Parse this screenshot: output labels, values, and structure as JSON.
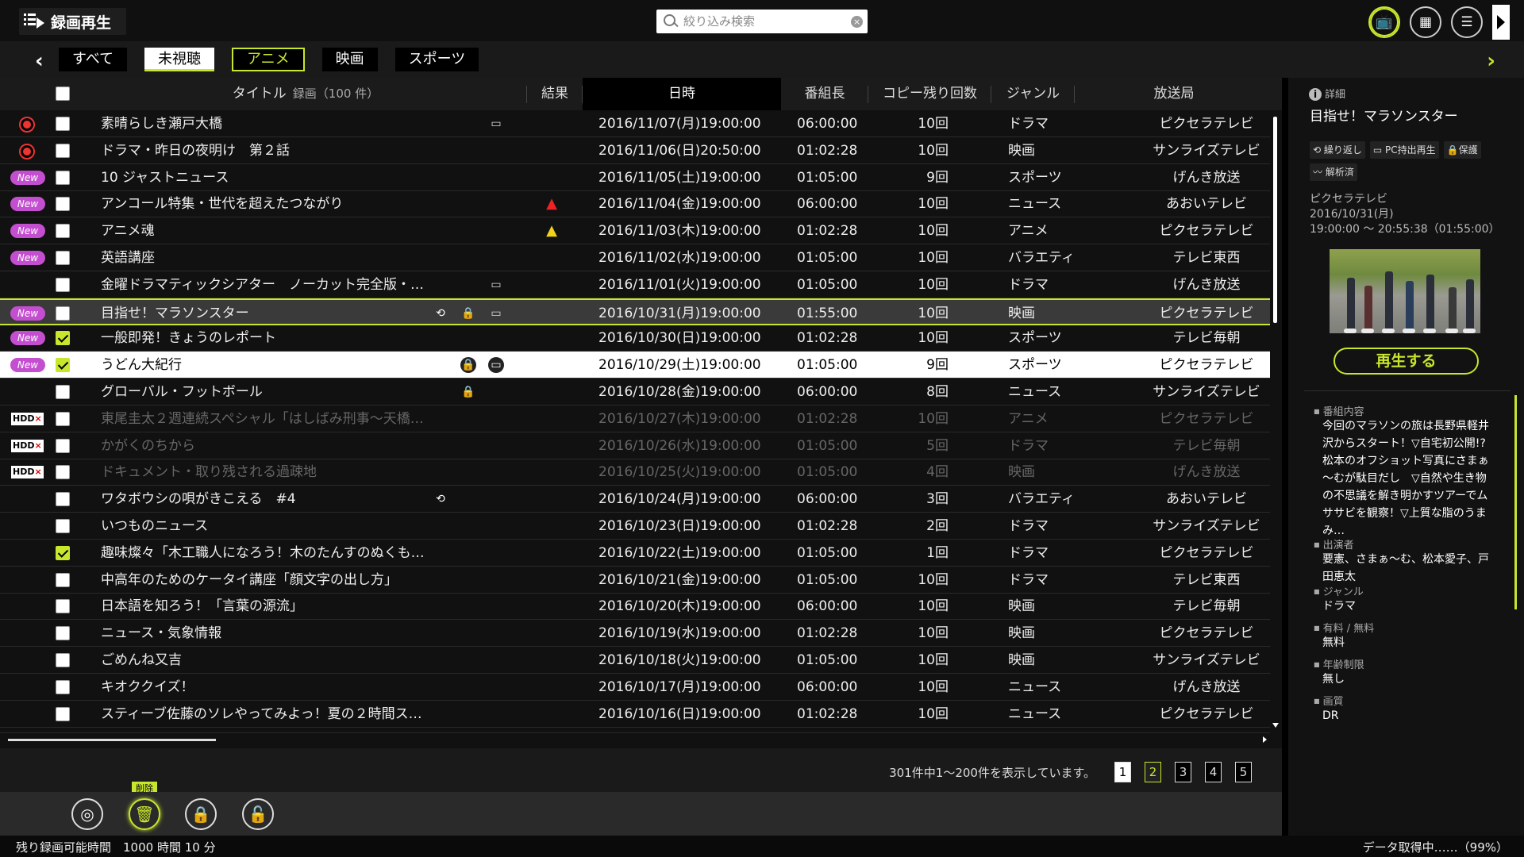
{
  "app": {
    "title": "録画再生"
  },
  "search": {
    "placeholder": "絞り込み検索"
  },
  "categories": [
    "すべて",
    "未視聴",
    "アニメ",
    "映画",
    "スポーツ"
  ],
  "table": {
    "headers": {
      "title": "タイトル",
      "title_sub": "録画（100 件）",
      "result": "結果",
      "date": "日時",
      "length": "番組長",
      "copy": "コピー残り回数",
      "genre": "ジャンル",
      "channel": "放送局"
    },
    "rows": [
      {
        "badge": "rec",
        "checked": false,
        "title": "素晴らしき瀬戸大橋",
        "date": "2016/11/07(月)19:00:00",
        "length": "06:00:00",
        "copy": "10回",
        "genre": "ドラマ",
        "channel": "ピクセラテレビ"
      },
      {
        "badge": "rec",
        "checked": false,
        "title": "ドラマ・昨日の夜明け　第２話",
        "date": "2016/11/06(日)20:50:00",
        "length": "01:02:28",
        "copy": "10回",
        "genre": "映画",
        "channel": "サンライズテレビ"
      },
      {
        "badge": "new",
        "checked": false,
        "title": "10 ジャストニュース",
        "date": "2016/11/05(土)19:00:00",
        "length": "01:05:00",
        "copy": "9回",
        "genre": "スポーツ",
        "channel": "げんき放送"
      },
      {
        "badge": "new",
        "checked": false,
        "title": "アンコール特集・世代を超えたつながり",
        "date": "2016/11/04(金)19:00:00",
        "length": "06:00:00",
        "copy": "10回",
        "genre": "ニュース",
        "channel": "あおいテレビ"
      },
      {
        "badge": "new",
        "checked": false,
        "title": "アニメ魂",
        "date": "2016/11/03(木)19:00:00",
        "length": "01:02:28",
        "copy": "10回",
        "genre": "アニメ",
        "channel": "ピクセラテレビ"
      },
      {
        "badge": "new",
        "checked": false,
        "title": "英語講座",
        "date": "2016/11/02(水)19:00:00",
        "length": "01:05:00",
        "copy": "10回",
        "genre": "バラエティ",
        "channel": "テレビ東西"
      },
      {
        "badge": "",
        "checked": false,
        "title": "金曜ドラマティックシアター　ノーカット完全版・…",
        "date": "2016/11/01(火)19:00:00",
        "length": "01:05:00",
        "copy": "10回",
        "genre": "ドラマ",
        "channel": "げんき放送"
      },
      {
        "badge": "new",
        "checked": false,
        "title": "目指せ！マラソンスター",
        "date": "2016/10/31(月)19:00:00",
        "length": "01:55:00",
        "copy": "10回",
        "genre": "映画",
        "channel": "ピクセラテレビ"
      },
      {
        "badge": "new",
        "checked": true,
        "title": "一般即発！きょうのレポート",
        "date": "2016/10/30(日)19:00:00",
        "length": "01:02:28",
        "copy": "10回",
        "genre": "スポーツ",
        "channel": "テレビ毎朝"
      },
      {
        "badge": "new",
        "checked": true,
        "title": "うどん大紀行",
        "date": "2016/10/29(土)19:00:00",
        "length": "01:05:00",
        "copy": "9回",
        "genre": "スポーツ",
        "channel": "ピクセラテレビ"
      },
      {
        "badge": "",
        "checked": false,
        "title": "グローバル・フットボール",
        "date": "2016/10/28(金)19:00:00",
        "length": "06:00:00",
        "copy": "8回",
        "genre": "ニュース",
        "channel": "サンライズテレビ"
      },
      {
        "badge": "hdd",
        "checked": false,
        "title": "東尾圭太２週連続スペシャル「はしばみ刑事～天橋…",
        "date": "2016/10/27(木)19:00:00",
        "length": "01:02:28",
        "copy": "10回",
        "genre": "アニメ",
        "channel": "ピクセラテレビ"
      },
      {
        "badge": "hdd",
        "checked": false,
        "title": "かがくのちから",
        "date": "2016/10/26(水)19:00:00",
        "length": "01:05:00",
        "copy": "5回",
        "genre": "ドラマ",
        "channel": "テレビ毎朝"
      },
      {
        "badge": "hdd",
        "checked": false,
        "title": "ドキュメント・取り残される過疎地",
        "date": "2016/10/25(火)19:00:00",
        "length": "01:05:00",
        "copy": "4回",
        "genre": "映画",
        "channel": "げんき放送"
      },
      {
        "badge": "",
        "checked": false,
        "title": "ワタボウシの唄がきこえる　#4",
        "date": "2016/10/24(月)19:00:00",
        "length": "06:00:00",
        "copy": "3回",
        "genre": "バラエティ",
        "channel": "あおいテレビ"
      },
      {
        "badge": "",
        "checked": false,
        "title": "いつものニュース",
        "date": "2016/10/23(日)19:00:00",
        "length": "01:02:28",
        "copy": "2回",
        "genre": "ドラマ",
        "channel": "サンライズテレビ"
      },
      {
        "badge": "",
        "checked": true,
        "title": "趣味燦々「木工職人になろう！木のたんすのぬくも…",
        "date": "2016/10/22(土)19:00:00",
        "length": "01:05:00",
        "copy": "1回",
        "genre": "ドラマ",
        "channel": "ピクセラテレビ"
      },
      {
        "badge": "",
        "checked": false,
        "title": "中高年のためのケータイ講座「顔文字の出し方」",
        "date": "2016/10/21(金)19:00:00",
        "length": "01:05:00",
        "copy": "10回",
        "genre": "ドラマ",
        "channel": "テレビ東西"
      },
      {
        "badge": "",
        "checked": false,
        "title": "日本語を知ろう！「言葉の源流」",
        "date": "2016/10/20(木)19:00:00",
        "length": "06:00:00",
        "copy": "10回",
        "genre": "映画",
        "channel": "テレビ毎朝"
      },
      {
        "badge": "",
        "checked": false,
        "title": "ニュース・気象情報",
        "date": "2016/10/19(水)19:00:00",
        "length": "01:02:28",
        "copy": "10回",
        "genre": "映画",
        "channel": "ピクセラテレビ"
      },
      {
        "badge": "",
        "checked": false,
        "title": "ごめんね又吉",
        "date": "2016/10/18(火)19:00:00",
        "length": "01:05:00",
        "copy": "10回",
        "genre": "映画",
        "channel": "サンライズテレビ"
      },
      {
        "badge": "",
        "checked": false,
        "title": "キオククイズ！",
        "date": "2016/10/17(月)19:00:00",
        "length": "06:00:00",
        "copy": "10回",
        "genre": "ニュース",
        "channel": "げんき放送"
      },
      {
        "badge": "",
        "checked": false,
        "title": "スティーブ佐藤のソレやってみよっ！夏の２時間ス…",
        "date": "2016/10/16(日)19:00:00",
        "length": "01:02:28",
        "copy": "10回",
        "genre": "ニュース",
        "channel": "ピクセラテレビ"
      }
    ]
  },
  "labels": {
    "new_badge": "New",
    "hdd_prefix": "HDD",
    "hdd_x": "×"
  },
  "pager": {
    "info": "301件中1～200件を表示しています。",
    "pages": [
      "1",
      "2",
      "3",
      "4",
      "5"
    ],
    "current": "2"
  },
  "actions": {
    "tooltip": "削除"
  },
  "status": {
    "left": "残り録画可能時間　1000 時間 10 分",
    "right": "データ取得中……（99%）"
  },
  "detail": {
    "header": "詳細",
    "title": "目指せ！マラソンスター",
    "tags": [
      "繰り返し",
      "PC持出再生",
      "保護",
      "解析済"
    ],
    "channel": "ピクセラテレビ",
    "date": "2016/10/31(月)",
    "time": "19:00:00 ～ 20:55:38（01:55:00）",
    "play_label": "再生する",
    "sections": {
      "content_label": "番組内容",
      "content": "今回のマラソンの旅は長野県軽井沢からスタート！▽自宅初公開!?　松本のオフショット写真にさまぁ～むが駄目だし　▽自然や生き物の不思議を解き明かすツアーでムササビを観察！▽上質な脂のうまみ…",
      "cast_label": "出演者",
      "cast": "要憲、さまぁ～む、松本愛子、戸田恵太",
      "genre_label": "ジャンル",
      "genre": "ドラマ",
      "fee_label": "有料 / 無料",
      "fee": "無料",
      "age_label": "年齢制限",
      "age": "無し",
      "quality_label": "画質",
      "quality": "DR"
    }
  },
  "colors": {
    "accent": "#c8e62c",
    "new_badge": "#c44ed0",
    "rec": "#e33333"
  }
}
